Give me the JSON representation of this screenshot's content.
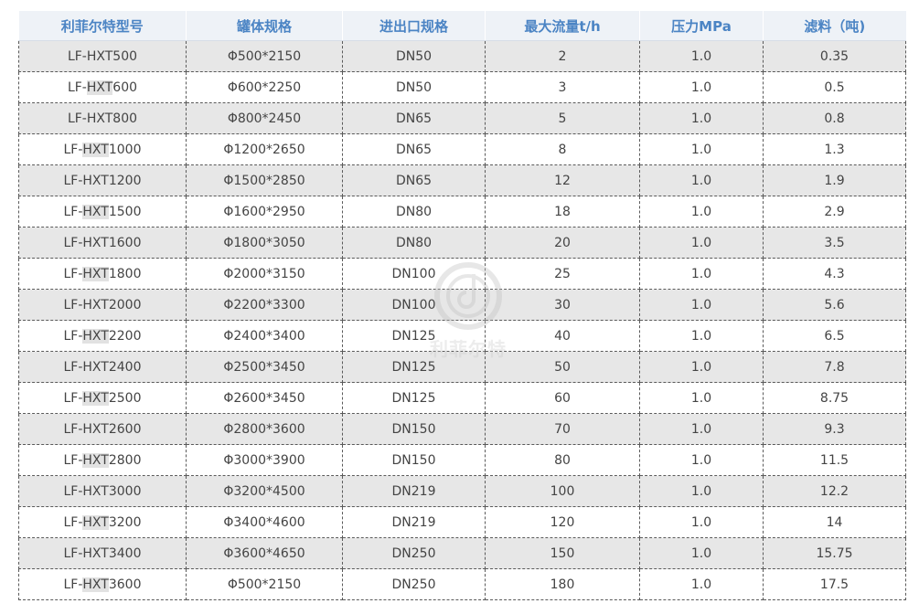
{
  "table": {
    "headers": [
      "利菲尔特型号",
      "罐体规格",
      "进出口规格",
      "最大流量t/h",
      "压力MPa",
      "滤料（吨)"
    ],
    "rows": [
      {
        "model_prefix": "LF-",
        "model_mid": "HXT",
        "model_num": "500",
        "tank": "Φ500*2150",
        "port": "DN50",
        "flow": "2",
        "pressure": "1.0",
        "media": "0.35"
      },
      {
        "model_prefix": "LF-",
        "model_mid": "HXT",
        "model_num": "600",
        "tank": "Φ600*2250",
        "port": "DN50",
        "flow": "3",
        "pressure": "1.0",
        "media": "0.5"
      },
      {
        "model_prefix": "LF-",
        "model_mid": "HXT",
        "model_num": "800",
        "tank": "Φ800*2450",
        "port": "DN65",
        "flow": "5",
        "pressure": "1.0",
        "media": "0.8"
      },
      {
        "model_prefix": "LF-",
        "model_mid": "HXT",
        "model_num": "1000",
        "tank": "Φ1200*2650",
        "port": "DN65",
        "flow": "8",
        "pressure": "1.0",
        "media": "1.3"
      },
      {
        "model_prefix": "LF-",
        "model_mid": "HXT",
        "model_num": "1200",
        "tank": "Φ1500*2850",
        "port": "DN65",
        "flow": "12",
        "pressure": "1.0",
        "media": "1.9"
      },
      {
        "model_prefix": "LF-",
        "model_mid": "HXT",
        "model_num": "1500",
        "tank": "Φ1600*2950",
        "port": "DN80",
        "flow": "18",
        "pressure": "1.0",
        "media": "2.9"
      },
      {
        "model_prefix": "LF-",
        "model_mid": "HXT",
        "model_num": "1600",
        "tank": "Φ1800*3050",
        "port": "DN80",
        "flow": "20",
        "pressure": "1.0",
        "media": "3.5"
      },
      {
        "model_prefix": "LF-",
        "model_mid": "HXT",
        "model_num": "1800",
        "tank": "Φ2000*3150",
        "port": "DN100",
        "flow": "25",
        "pressure": "1.0",
        "media": "4.3"
      },
      {
        "model_prefix": "LF-",
        "model_mid": "HXT",
        "model_num": "2000",
        "tank": "Φ2200*3300",
        "port": "DN100",
        "flow": "30",
        "pressure": "1.0",
        "media": "5.6"
      },
      {
        "model_prefix": "LF-",
        "model_mid": "HXT",
        "model_num": "2200",
        "tank": "Φ2400*3400",
        "port": "DN125",
        "flow": "40",
        "pressure": "1.0",
        "media": "6.5"
      },
      {
        "model_prefix": "LF-",
        "model_mid": "HXT",
        "model_num": "2400",
        "tank": "Φ2500*3450",
        "port": "DN125",
        "flow": "50",
        "pressure": "1.0",
        "media": "7.8"
      },
      {
        "model_prefix": "LF-",
        "model_mid": "HXT",
        "model_num": "2500",
        "tank": "Φ2600*3450",
        "port": "DN125",
        "flow": "60",
        "pressure": "1.0",
        "media": "8.75"
      },
      {
        "model_prefix": "LF-",
        "model_mid": "HXT",
        "model_num": "2600",
        "tank": "Φ2800*3600",
        "port": "DN150",
        "flow": "70",
        "pressure": "1.0",
        "media": "9.3"
      },
      {
        "model_prefix": "LF-",
        "model_mid": "HXT",
        "model_num": "2800",
        "tank": "Φ3000*3900",
        "port": "DN150",
        "flow": "80",
        "pressure": "1.0",
        "media": "11.5"
      },
      {
        "model_prefix": "LF-",
        "model_mid": "HXT",
        "model_num": "3000",
        "tank": "Φ3200*4500",
        "port": "DN219",
        "flow": "100",
        "pressure": "1.0",
        "media": "12.2"
      },
      {
        "model_prefix": "LF-",
        "model_mid": "HXT",
        "model_num": "3200",
        "tank": "Φ3400*4600",
        "port": "DN219",
        "flow": "120",
        "pressure": "1.0",
        "media": "14"
      },
      {
        "model_prefix": "LF-",
        "model_mid": "HXT",
        "model_num": "3400",
        "tank": "Φ3600*4650",
        "port": "DN250",
        "flow": "150",
        "pressure": "1.0",
        "media": "15.75"
      },
      {
        "model_prefix": "LF-",
        "model_mid": "HXT",
        "model_num": "3600",
        "tank": "Φ500*2150",
        "port": "DN250",
        "flow": "180",
        "pressure": "1.0",
        "media": "17.5"
      }
    ],
    "highlighted_model_rows": [
      1,
      3,
      5,
      7,
      9,
      11,
      13,
      15,
      17
    ]
  },
  "watermark": {
    "text": "利菲尔特",
    "icon": "watermark-logo-icon"
  }
}
